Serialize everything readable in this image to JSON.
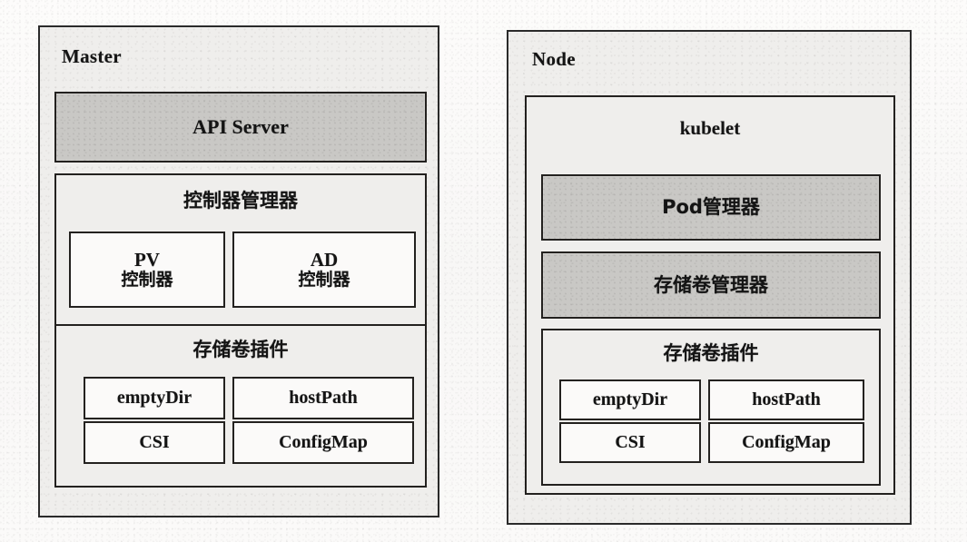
{
  "diagram": {
    "title_master": "Master",
    "title_node": "Node",
    "panels": [
      {
        "name": "master",
        "title": "Master",
        "blocks": {
          "api_server": "API Server",
          "controller_manager": "控制器管理器",
          "pv_controller_line1": "PV",
          "pv_controller_line2": "控制器",
          "ad_controller_line1": "AD",
          "ad_controller_line2": "控制器",
          "volume_plugin": "存储卷插件",
          "plugins": [
            "emptyDir",
            "hostPath",
            "CSI",
            "ConfigMap"
          ]
        }
      },
      {
        "name": "node",
        "title": "Node",
        "blocks": {
          "kubelet": "kubelet",
          "pod_manager": "Pod管理器",
          "volume_manager": "存储卷管理器",
          "volume_plugin": "存储卷插件",
          "plugins": [
            "emptyDir",
            "hostPath",
            "CSI",
            "ConfigMap"
          ]
        }
      }
    ],
    "colors": {
      "paper_background": "#fbfafa",
      "panel_fill": "#efeeec",
      "shaded_fill": "#c9c8c5",
      "white_fill": "#fbfaf9",
      "stroke": "#23211f",
      "text": "#141414"
    }
  }
}
